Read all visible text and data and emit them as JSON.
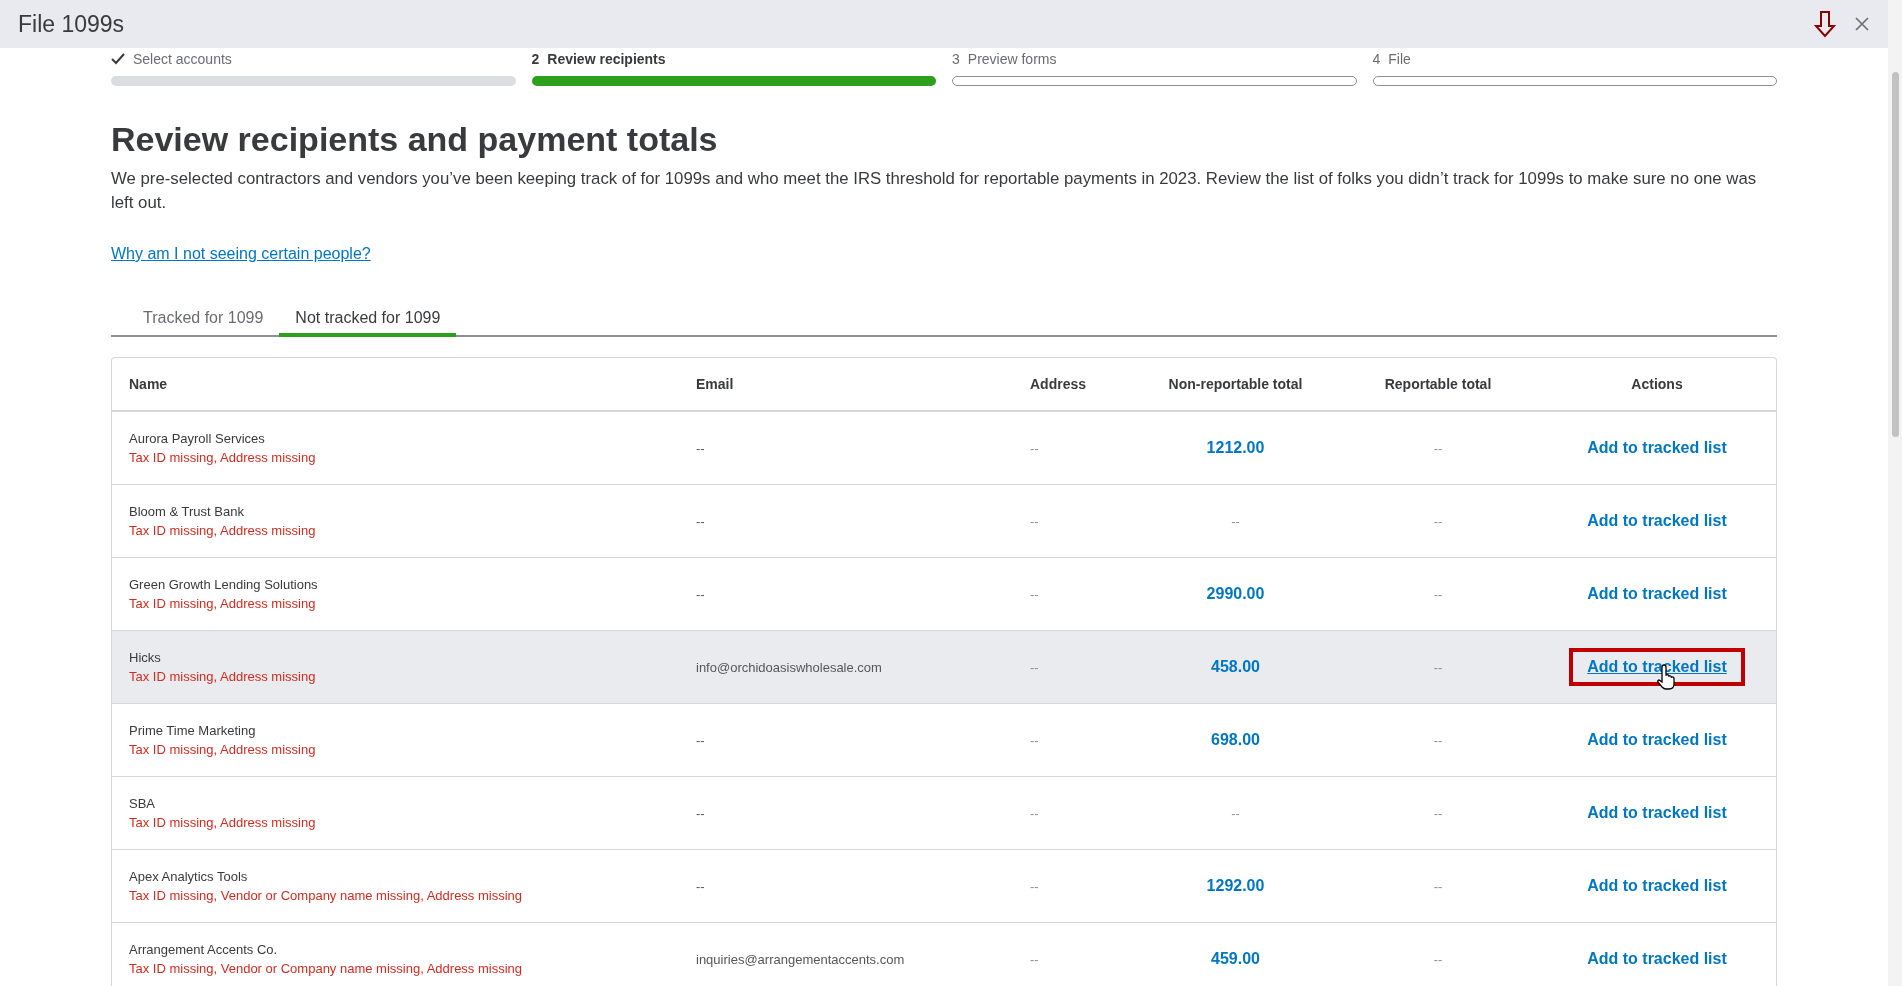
{
  "window": {
    "title": "File 1099s"
  },
  "steps": [
    {
      "label": "Select accounts",
      "completed": true,
      "selected": false
    },
    {
      "number": "2",
      "label": "Review recipients",
      "completed": false,
      "selected": true
    },
    {
      "number": "3",
      "label": "Preview forms",
      "completed": false,
      "selected": false
    },
    {
      "number": "4",
      "label": "File",
      "completed": false,
      "selected": false
    }
  ],
  "heading": "Review recipients and payment totals",
  "description": "We pre-selected contractors and vendors you’ve been keeping track of for 1099s and who meet the IRS threshold for reportable payments in 2023. Review the list of folks you didn’t track for 1099s to make sure no one was left out.",
  "help_link": "Why am I not seeing certain people?",
  "tabs": [
    {
      "label": "Tracked for 1099",
      "selected": false
    },
    {
      "label": "Not tracked for 1099",
      "selected": true
    }
  ],
  "table": {
    "columns": [
      "Name",
      "Email",
      "Address",
      "Non-reportable total",
      "Reportable total",
      "Actions"
    ],
    "rows": [
      {
        "name": "Aurora Payroll Services",
        "warning": "Tax ID missing, Address missing",
        "email": "--",
        "address": "--",
        "non_reportable": "1212.00",
        "non_reportable_linked": true,
        "reportable": "--",
        "action": "Add to tracked list",
        "highlighted": false
      },
      {
        "name": "Bloom & Trust Bank",
        "warning": "Tax ID missing, Address missing",
        "email": "--",
        "address": "--",
        "non_reportable": "--",
        "non_reportable_linked": false,
        "reportable": "--",
        "action": "Add to tracked list",
        "highlighted": false
      },
      {
        "name": "Green Growth Lending Solutions",
        "warning": "Tax ID missing, Address missing",
        "email": "--",
        "address": "--",
        "non_reportable": "2990.00",
        "non_reportable_linked": true,
        "reportable": "--",
        "action": "Add to tracked list",
        "highlighted": false
      },
      {
        "name": "Hicks",
        "warning": "Tax ID missing, Address missing",
        "email": "info@orchidoasiswholesale.com",
        "address": "--",
        "non_reportable": "458.00",
        "non_reportable_linked": true,
        "reportable": "--",
        "action": "Add to tracked list",
        "highlighted": true
      },
      {
        "name": "Prime Time Marketing",
        "warning": "Tax ID missing, Address missing",
        "email": "--",
        "address": "--",
        "non_reportable": "698.00",
        "non_reportable_linked": true,
        "reportable": "--",
        "action": "Add to tracked list",
        "highlighted": false
      },
      {
        "name": "SBA",
        "warning": "Tax ID missing, Address missing",
        "email": "--",
        "address": "--",
        "non_reportable": "--",
        "non_reportable_linked": false,
        "reportable": "--",
        "action": "Add to tracked list",
        "highlighted": false
      },
      {
        "name": "Apex Analytics Tools",
        "warning": "Tax ID missing, Vendor or Company name missing, Address missing",
        "email": "--",
        "address": "--",
        "non_reportable": "1292.00",
        "non_reportable_linked": true,
        "reportable": "--",
        "action": "Add to tracked list",
        "highlighted": false
      },
      {
        "name": "Arrangement Accents Co.",
        "warning": "Tax ID missing, Vendor or Company name missing, Address missing",
        "email": "inquiries@arrangementaccents.com",
        "address": "--",
        "non_reportable": "459.00",
        "non_reportable_linked": true,
        "reportable": "--",
        "action": "Add to tracked list",
        "highlighted": false
      }
    ]
  }
}
